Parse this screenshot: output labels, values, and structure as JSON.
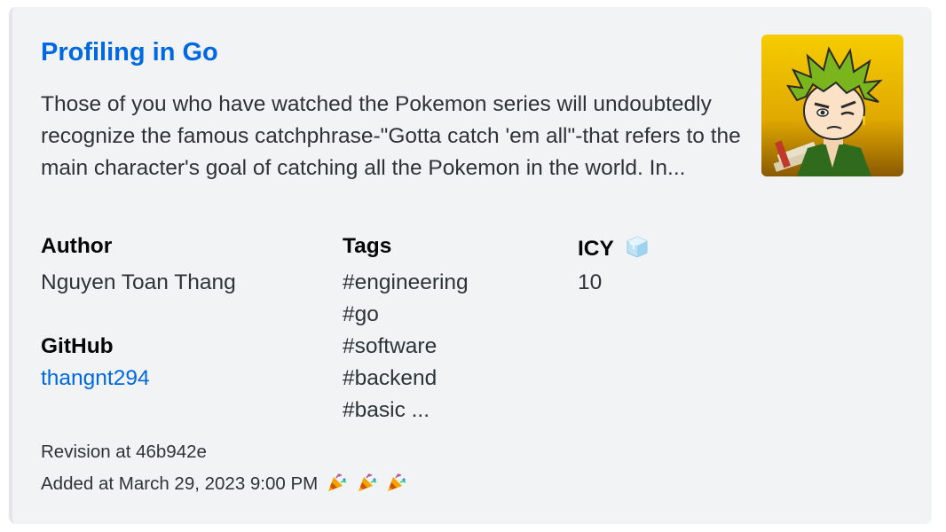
{
  "embed": {
    "title": "Profiling in Go",
    "description": "Those of you who have watched the Pokemon series will undoubtedly recognize the famous catchphrase-\"Gotta catch 'em all\"-that refers to the main character's goal of catching all the Pokemon in the world. In...",
    "thumbnail_icon": "anime-avatar-thumbnail",
    "fields": {
      "author": {
        "name": "Author",
        "value": "Nguyen Toan Thang"
      },
      "tags": {
        "name": "Tags",
        "values": [
          "#engineering",
          "#go",
          "#software",
          "#backend",
          "#basic ..."
        ]
      },
      "icy": {
        "name": "ICY",
        "icon": "ice-cube-emoji",
        "value": "10"
      },
      "github": {
        "name": "GitHub",
        "value": "thangnt294"
      }
    },
    "footer": {
      "revision": "Revision at 46b942e",
      "added": "Added at March 29, 2023 9:00 PM",
      "emoji": [
        "party-popper-emoji",
        "party-popper-emoji",
        "party-popper-emoji"
      ]
    },
    "colors": {
      "link": "#0068e0",
      "background": "#f2f3f5",
      "text": "#2e3338"
    }
  }
}
